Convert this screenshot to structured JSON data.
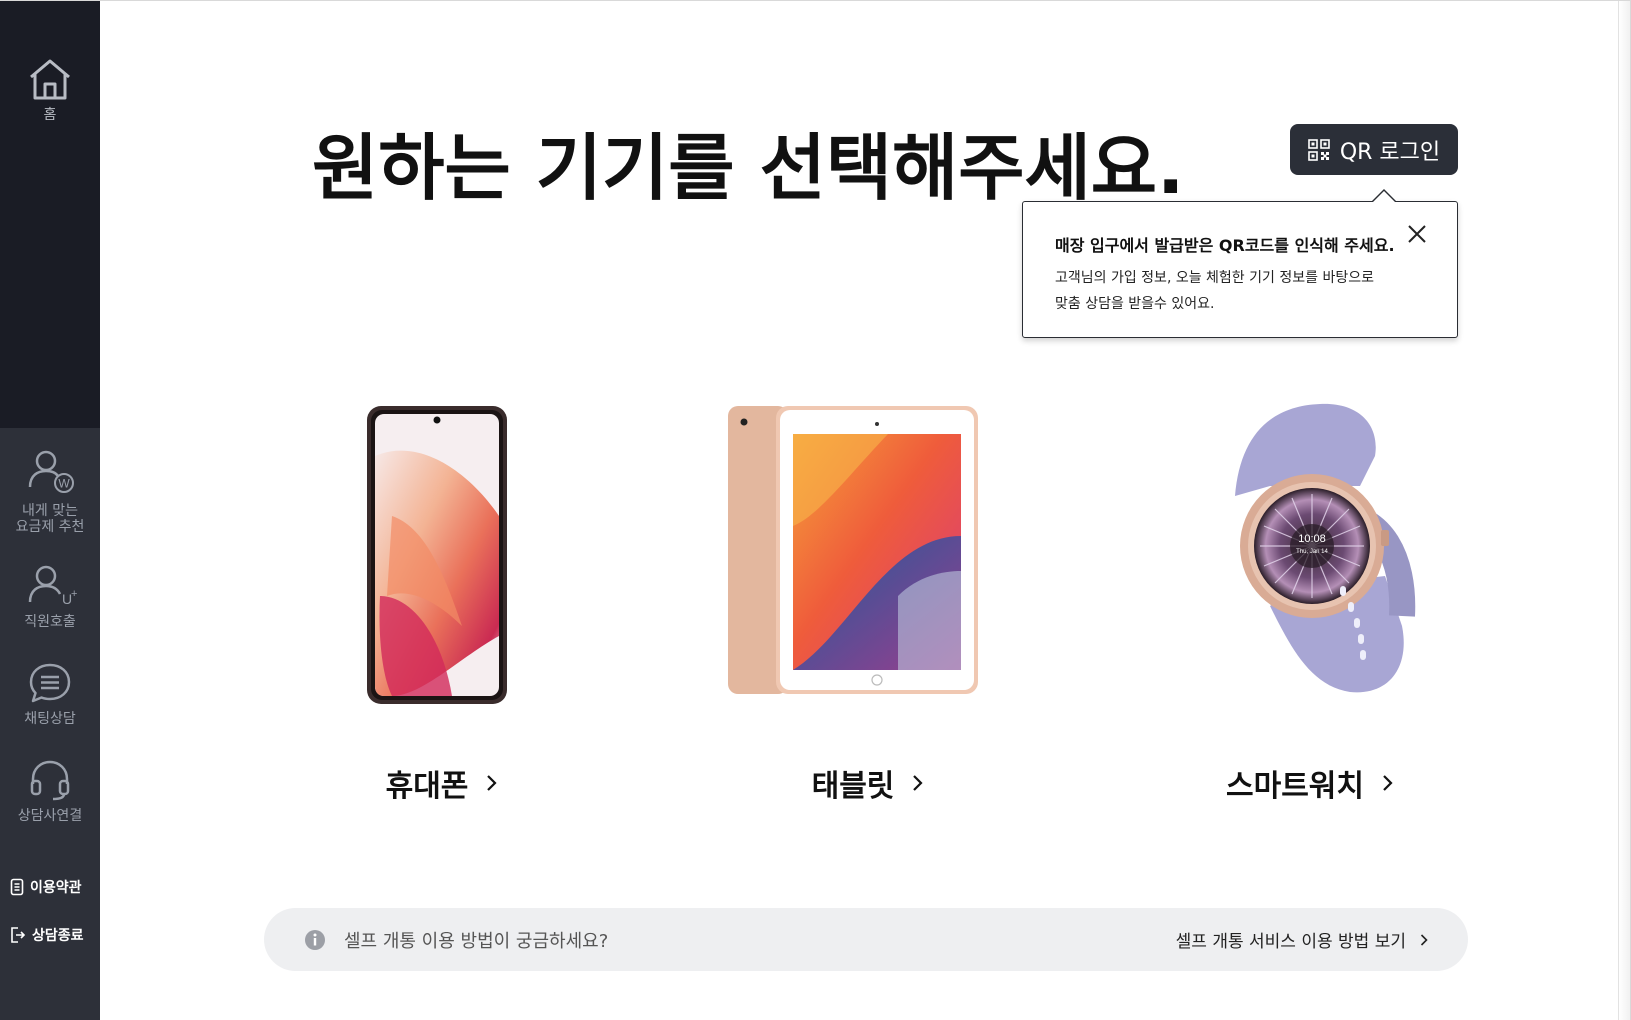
{
  "sidebar": {
    "home_label": "홈",
    "items": [
      {
        "label": "내게 맞는\n요금제 추천",
        "icon": "person-w-icon"
      },
      {
        "label": "직원호출",
        "icon": "person-uplus-icon"
      },
      {
        "label": "채팅상담",
        "icon": "chat-bubble-icon"
      },
      {
        "label": "상담사연결",
        "icon": "headset-icon"
      }
    ],
    "terms_label": "이용약관",
    "end_label": "상담종료"
  },
  "headline": "원하는 기기를 선택해주세요.",
  "qr_button": {
    "label": "QR 로그인",
    "icon": "qr-code-icon"
  },
  "tooltip": {
    "title": "매장 입구에서 발급받은 QR코드를 인식해 주세요.",
    "body": "고객님의 가입 정보, 오늘 체험한 기기 정보를 바탕으로\n맞춤 상담을 받을수 있어요."
  },
  "devices": [
    {
      "label": "휴대폰"
    },
    {
      "label": "태블릿"
    },
    {
      "label": "스마트워치",
      "screen_time": "10:08",
      "screen_date": "Thu, Jan 14"
    }
  ],
  "help_bar": {
    "question": "셀프 개통 이용 방법이 궁금하세요?",
    "link": "셀프 개통 서비스 이용 방법 보기"
  },
  "colors": {
    "sidebar_top": "#1a1c25",
    "sidebar_bottom": "#2d3039",
    "qr_button": "#2b2f38",
    "help_bar": "#eeeff1"
  }
}
